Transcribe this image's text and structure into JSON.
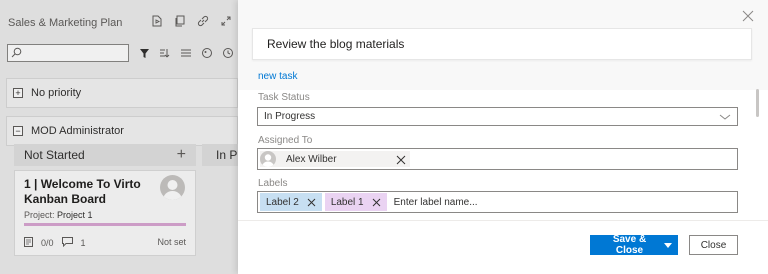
{
  "board": {
    "title": "Sales & Marketing Plan",
    "tool_icons": [
      "document-icon",
      "copy-icon",
      "link-icon",
      "expand-icon"
    ],
    "search_placeholder": "",
    "filter_icons": [
      "filter-icon",
      "group-icon",
      "swimlane-icon",
      "color-icon",
      "history-icon"
    ],
    "groups": [
      {
        "label": "No priority",
        "toggle": "+"
      },
      {
        "label": "MOD Administrator",
        "toggle": "−"
      }
    ],
    "columns": [
      {
        "name": "Not Started",
        "add": "+"
      },
      {
        "name": "In Pr"
      }
    ],
    "card": {
      "title": "1 | Welcome To Virto Kanban Board",
      "project_label": "Project:",
      "project_name": "Project 1",
      "checklist": "0/0",
      "comments": "1",
      "due": "Not set",
      "bar_color": "#d9a6d3"
    }
  },
  "panel": {
    "task_title": "Review the blog materials",
    "new_task_link": "new task",
    "fields": {
      "status_label": "Task Status",
      "status_value": "In Progress",
      "assigned_label": "Assigned To",
      "assignee": "Alex Wilber",
      "labels_label": "Labels",
      "labels": [
        {
          "name": "Label 2",
          "color": "#c7dff2"
        },
        {
          "name": "Label 1",
          "color": "#ead3f2"
        }
      ],
      "label_placeholder": "Enter label name..."
    },
    "footer": {
      "save_label": "Save & Close",
      "close_label": "Close"
    }
  },
  "colors": {
    "accent": "#0078d4"
  }
}
